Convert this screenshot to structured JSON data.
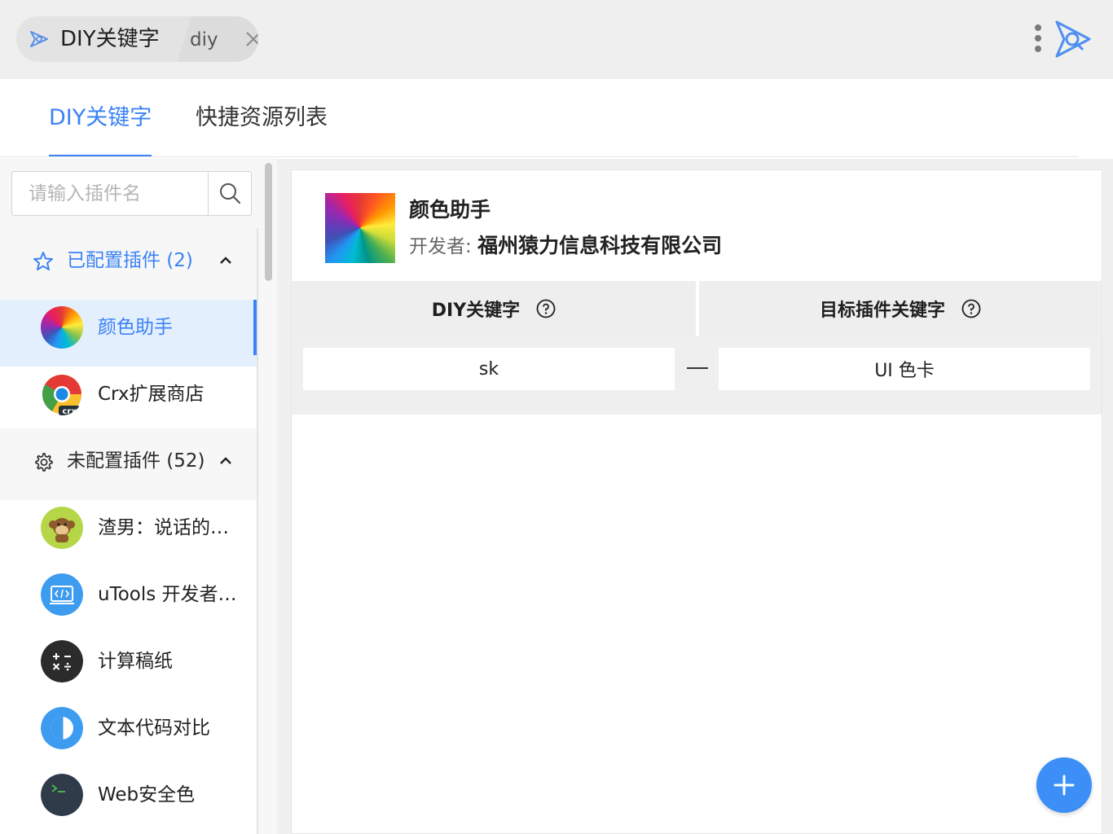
{
  "header": {
    "title": "DIY关键字",
    "subtitle": "diy",
    "close_icon": "close-icon",
    "more_icon": "more-vertical-icon",
    "brand_icon": "utools-logo-icon"
  },
  "tabs": [
    {
      "label": "DIY关键字",
      "active": true
    },
    {
      "label": "快捷资源列表",
      "active": false
    }
  ],
  "sidebar": {
    "search_placeholder": "请输入插件名",
    "search_value": "",
    "configured_group": {
      "label": "已配置插件 (2)",
      "icon": "star-icon",
      "expanded": true
    },
    "configured_items": [
      {
        "name": "颜色助手",
        "icon": "color-wheel-icon",
        "selected": true
      },
      {
        "name": "Crx扩展商店",
        "icon": "chrome-crx-icon",
        "selected": false
      }
    ],
    "unconfigured_group": {
      "label": "未配置插件 (52)",
      "icon": "gear-icon",
      "expanded": true
    },
    "unconfigured_items": [
      {
        "name": "渣男：说话的艺术",
        "icon": "monkey-icon"
      },
      {
        "name": "uTools 开发者工具",
        "icon": "code-window-icon"
      },
      {
        "name": "计算稿纸",
        "icon": "calculator-icon"
      },
      {
        "name": "文本代码对比",
        "icon": "diff-icon"
      },
      {
        "name": "Web安全色",
        "icon": "terminal-icon"
      }
    ]
  },
  "detail": {
    "plugin_name": "颜色助手",
    "developer_prefix": "开发者:",
    "developer_name": "福州猿力信息科技有限公司",
    "table": {
      "headers": [
        "DIY关键字",
        "目标插件关键字"
      ],
      "rows": [
        {
          "diy_keyword": "sk",
          "target_keyword": "UI 色卡"
        }
      ]
    }
  },
  "actions": {
    "add_icon": "plus-icon"
  },
  "colors": {
    "accent": "#3b82f6",
    "selected_bg": "#e4effd"
  }
}
